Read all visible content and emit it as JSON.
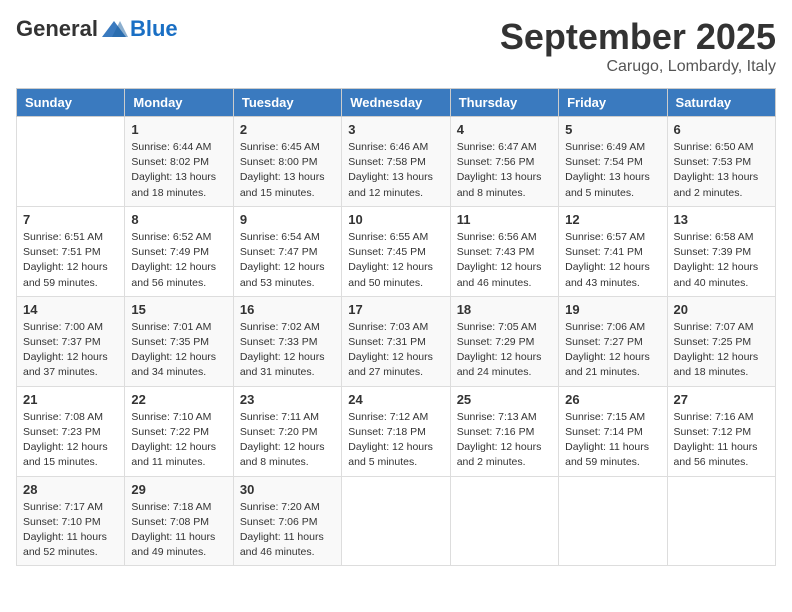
{
  "header": {
    "logo_general": "General",
    "logo_blue": "Blue",
    "month": "September 2025",
    "location": "Carugo, Lombardy, Italy"
  },
  "weekdays": [
    "Sunday",
    "Monday",
    "Tuesday",
    "Wednesday",
    "Thursday",
    "Friday",
    "Saturday"
  ],
  "weeks": [
    [
      {
        "day": "",
        "info": ""
      },
      {
        "day": "1",
        "info": "Sunrise: 6:44 AM\nSunset: 8:02 PM\nDaylight: 13 hours\nand 18 minutes."
      },
      {
        "day": "2",
        "info": "Sunrise: 6:45 AM\nSunset: 8:00 PM\nDaylight: 13 hours\nand 15 minutes."
      },
      {
        "day": "3",
        "info": "Sunrise: 6:46 AM\nSunset: 7:58 PM\nDaylight: 13 hours\nand 12 minutes."
      },
      {
        "day": "4",
        "info": "Sunrise: 6:47 AM\nSunset: 7:56 PM\nDaylight: 13 hours\nand 8 minutes."
      },
      {
        "day": "5",
        "info": "Sunrise: 6:49 AM\nSunset: 7:54 PM\nDaylight: 13 hours\nand 5 minutes."
      },
      {
        "day": "6",
        "info": "Sunrise: 6:50 AM\nSunset: 7:53 PM\nDaylight: 13 hours\nand 2 minutes."
      }
    ],
    [
      {
        "day": "7",
        "info": "Sunrise: 6:51 AM\nSunset: 7:51 PM\nDaylight: 12 hours\nand 59 minutes."
      },
      {
        "day": "8",
        "info": "Sunrise: 6:52 AM\nSunset: 7:49 PM\nDaylight: 12 hours\nand 56 minutes."
      },
      {
        "day": "9",
        "info": "Sunrise: 6:54 AM\nSunset: 7:47 PM\nDaylight: 12 hours\nand 53 minutes."
      },
      {
        "day": "10",
        "info": "Sunrise: 6:55 AM\nSunset: 7:45 PM\nDaylight: 12 hours\nand 50 minutes."
      },
      {
        "day": "11",
        "info": "Sunrise: 6:56 AM\nSunset: 7:43 PM\nDaylight: 12 hours\nand 46 minutes."
      },
      {
        "day": "12",
        "info": "Sunrise: 6:57 AM\nSunset: 7:41 PM\nDaylight: 12 hours\nand 43 minutes."
      },
      {
        "day": "13",
        "info": "Sunrise: 6:58 AM\nSunset: 7:39 PM\nDaylight: 12 hours\nand 40 minutes."
      }
    ],
    [
      {
        "day": "14",
        "info": "Sunrise: 7:00 AM\nSunset: 7:37 PM\nDaylight: 12 hours\nand 37 minutes."
      },
      {
        "day": "15",
        "info": "Sunrise: 7:01 AM\nSunset: 7:35 PM\nDaylight: 12 hours\nand 34 minutes."
      },
      {
        "day": "16",
        "info": "Sunrise: 7:02 AM\nSunset: 7:33 PM\nDaylight: 12 hours\nand 31 minutes."
      },
      {
        "day": "17",
        "info": "Sunrise: 7:03 AM\nSunset: 7:31 PM\nDaylight: 12 hours\nand 27 minutes."
      },
      {
        "day": "18",
        "info": "Sunrise: 7:05 AM\nSunset: 7:29 PM\nDaylight: 12 hours\nand 24 minutes."
      },
      {
        "day": "19",
        "info": "Sunrise: 7:06 AM\nSunset: 7:27 PM\nDaylight: 12 hours\nand 21 minutes."
      },
      {
        "day": "20",
        "info": "Sunrise: 7:07 AM\nSunset: 7:25 PM\nDaylight: 12 hours\nand 18 minutes."
      }
    ],
    [
      {
        "day": "21",
        "info": "Sunrise: 7:08 AM\nSunset: 7:23 PM\nDaylight: 12 hours\nand 15 minutes."
      },
      {
        "day": "22",
        "info": "Sunrise: 7:10 AM\nSunset: 7:22 PM\nDaylight: 12 hours\nand 11 minutes."
      },
      {
        "day": "23",
        "info": "Sunrise: 7:11 AM\nSunset: 7:20 PM\nDaylight: 12 hours\nand 8 minutes."
      },
      {
        "day": "24",
        "info": "Sunrise: 7:12 AM\nSunset: 7:18 PM\nDaylight: 12 hours\nand 5 minutes."
      },
      {
        "day": "25",
        "info": "Sunrise: 7:13 AM\nSunset: 7:16 PM\nDaylight: 12 hours\nand 2 minutes."
      },
      {
        "day": "26",
        "info": "Sunrise: 7:15 AM\nSunset: 7:14 PM\nDaylight: 11 hours\nand 59 minutes."
      },
      {
        "day": "27",
        "info": "Sunrise: 7:16 AM\nSunset: 7:12 PM\nDaylight: 11 hours\nand 56 minutes."
      }
    ],
    [
      {
        "day": "28",
        "info": "Sunrise: 7:17 AM\nSunset: 7:10 PM\nDaylight: 11 hours\nand 52 minutes."
      },
      {
        "day": "29",
        "info": "Sunrise: 7:18 AM\nSunset: 7:08 PM\nDaylight: 11 hours\nand 49 minutes."
      },
      {
        "day": "30",
        "info": "Sunrise: 7:20 AM\nSunset: 7:06 PM\nDaylight: 11 hours\nand 46 minutes."
      },
      {
        "day": "",
        "info": ""
      },
      {
        "day": "",
        "info": ""
      },
      {
        "day": "",
        "info": ""
      },
      {
        "day": "",
        "info": ""
      }
    ]
  ]
}
